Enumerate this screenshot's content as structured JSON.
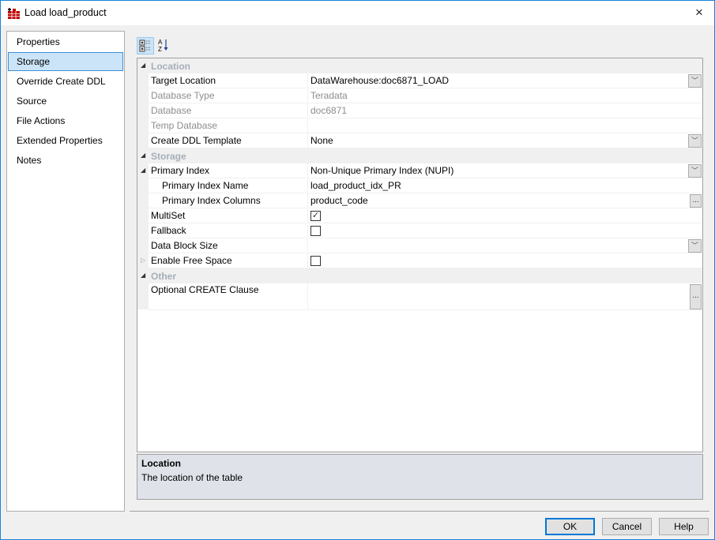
{
  "window": {
    "title": "Load load_product",
    "close_icon": "×"
  },
  "nav": {
    "items": [
      {
        "label": "Properties"
      },
      {
        "label": "Storage",
        "selected": true
      },
      {
        "label": "Override Create DDL"
      },
      {
        "label": "Source"
      },
      {
        "label": "File Actions"
      },
      {
        "label": "Extended Properties"
      },
      {
        "label": "Notes"
      }
    ]
  },
  "toolbar": {
    "categorized": "categorized-view",
    "alphabetical": "alphabetical-sort"
  },
  "grid": {
    "rows": [
      {
        "type": "cat",
        "label": "Location"
      },
      {
        "name": "Target Location",
        "value": "DataWarehouse:doc6871_LOAD",
        "editor": "dropdown"
      },
      {
        "name": "Database Type",
        "value": "Teradata",
        "readonly": true
      },
      {
        "name": "Database",
        "value": "doc6871",
        "readonly": true
      },
      {
        "name": "Temp Database",
        "value": "",
        "readonly": true
      },
      {
        "name": "Create DDL Template",
        "value": "None",
        "editor": "dropdown"
      },
      {
        "type": "cat",
        "label": "Storage"
      },
      {
        "name": "Primary Index",
        "value": "Non-Unique Primary Index (NUPI)",
        "editor": "dropdown",
        "expander": "open"
      },
      {
        "name": "Primary Index Name",
        "value": "load_product_idx_PR",
        "indent": true
      },
      {
        "name": "Primary Index Columns",
        "value": "product_code",
        "indent": true,
        "editor": "ellipsis"
      },
      {
        "name": "MultiSet",
        "checkbox": true,
        "checked": true
      },
      {
        "name": "Fallback",
        "checkbox": true,
        "checked": false
      },
      {
        "name": "Data Block Size",
        "value": "",
        "editor": "dropdown"
      },
      {
        "name": "Enable Free Space",
        "checkbox": true,
        "checked": false,
        "expander": "closed"
      },
      {
        "type": "cat",
        "label": "Other"
      },
      {
        "name": "Optional CREATE Clause",
        "value": "",
        "editor": "ellipsis",
        "tall": true
      }
    ]
  },
  "description": {
    "title": "Location",
    "text": "The location of the table"
  },
  "buttons": {
    "ok": "OK",
    "cancel": "Cancel",
    "help": "Help"
  }
}
